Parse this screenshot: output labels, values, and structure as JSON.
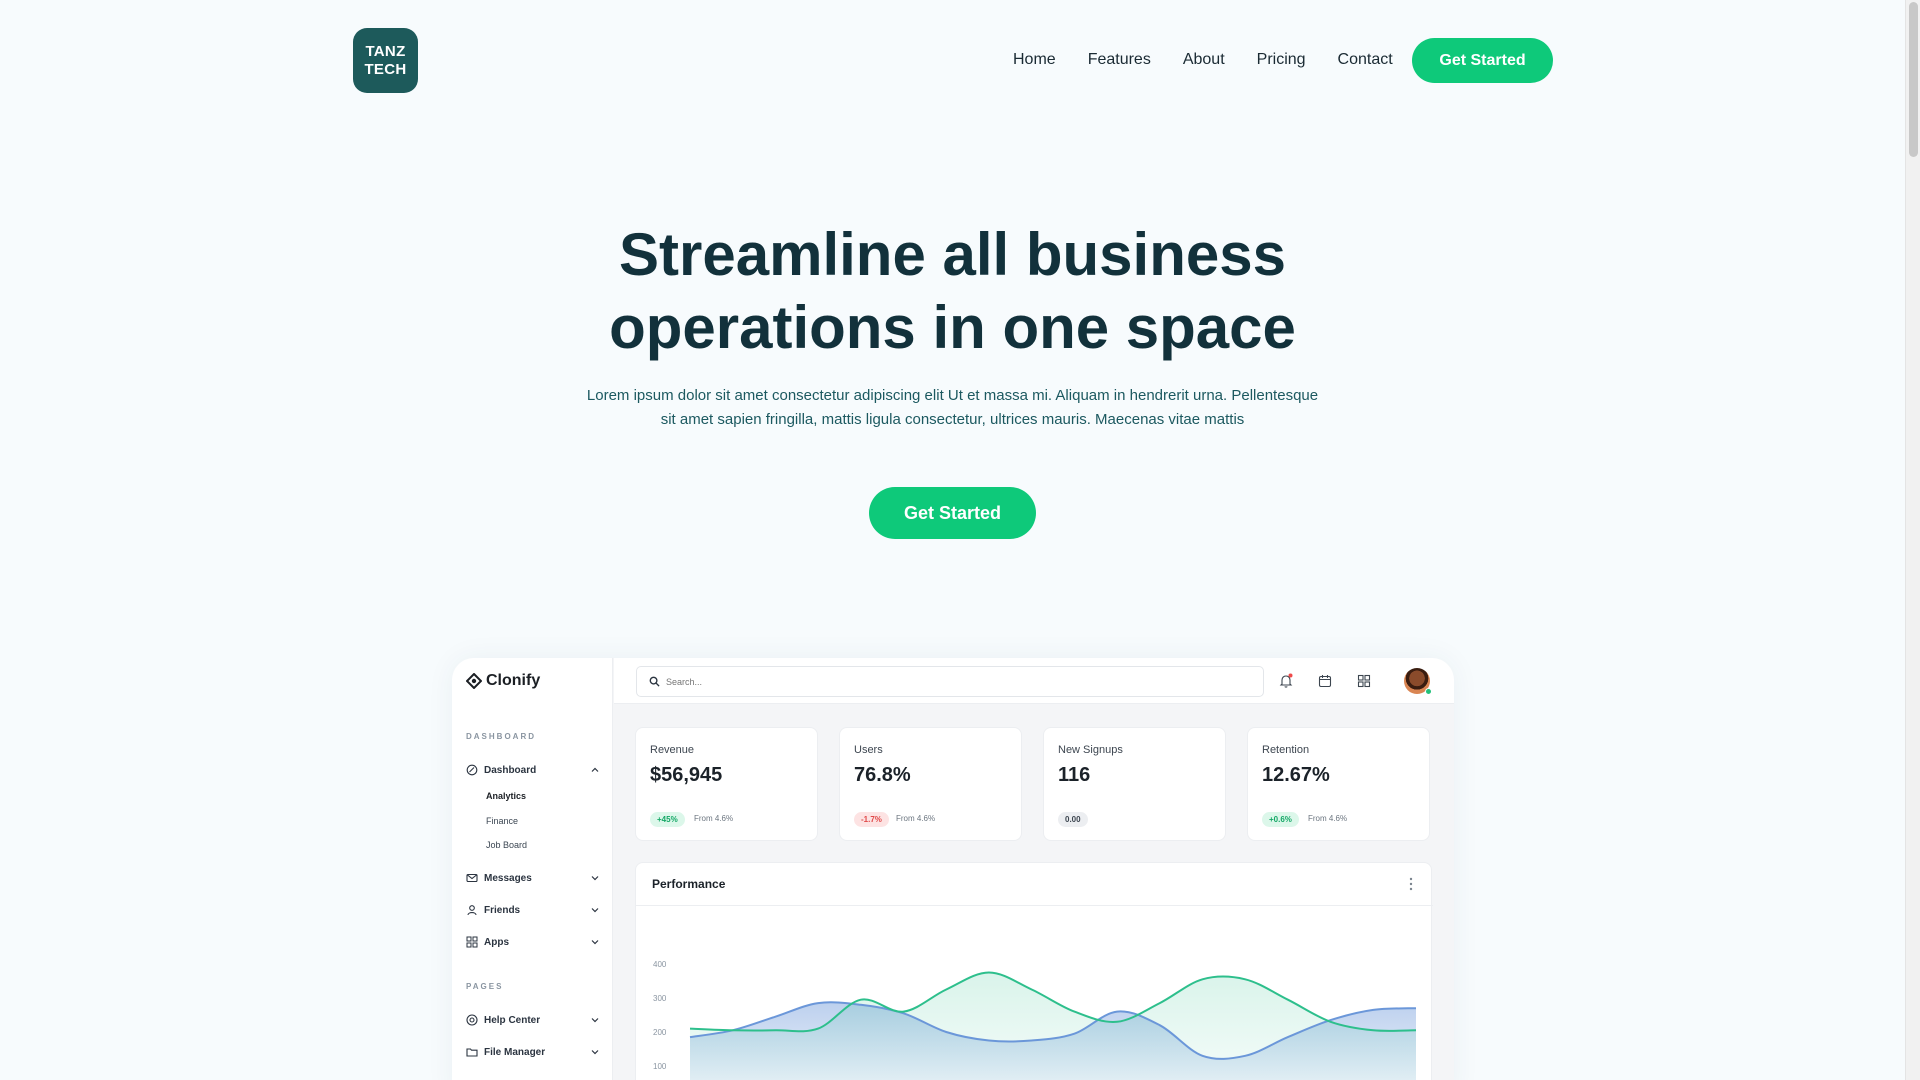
{
  "nav": {
    "logo_line1": "TANZ",
    "logo_line2": "TECH",
    "links": [
      "Home",
      "Features",
      "About",
      "Pricing",
      "Contact"
    ],
    "cta": "Get Started"
  },
  "hero": {
    "title_line1": "Streamline all business",
    "title_line2": "operations in one space",
    "subtitle_line1": "Lorem ipsum dolor sit amet consectetur adipiscing elit Ut et massa mi. Aliquam in hendrerit urna. Pellentesque",
    "subtitle_line2": "sit amet sapien fringilla, mattis ligula consectetur, ultrices mauris. Maecenas vitae mattis",
    "cta": "Get Started"
  },
  "dashboard": {
    "brand": "Clonify",
    "search_placeholder": "Search...",
    "sidebar": {
      "section1": "DASHBOARD",
      "dashboard": "Dashboard",
      "sub": [
        "Analytics",
        "Finance",
        "Job Board"
      ],
      "messages": "Messages",
      "friends": "Friends",
      "apps": "Apps",
      "section2": "PAGES",
      "help": "Help Center",
      "files": "File Manager"
    },
    "cards": [
      {
        "label": "Revenue",
        "value": "$56,945",
        "change": "+45%",
        "from": "From 4.6%",
        "trend": "up"
      },
      {
        "label": "Users",
        "value": "76.8%",
        "change": "-1.7%",
        "from": "From 4.6%",
        "trend": "down"
      },
      {
        "label": "New Signups",
        "value": "116",
        "change": "0.00",
        "from": "",
        "trend": "flat"
      },
      {
        "label": "Retention",
        "value": "12.67%",
        "change": "+0.6%",
        "from": "From 4.6%",
        "trend": "up"
      }
    ],
    "performance": {
      "title": "Performance"
    }
  },
  "colors": {
    "accent": "#0ec97a",
    "logo_bg": "#1d5a5b",
    "heading": "#12313b",
    "green_series": "#2dbf8c",
    "blue_series": "#6b97d9"
  },
  "chart_data": {
    "type": "area",
    "yticks": [
      "400",
      "300",
      "200",
      "100"
    ],
    "ylim": [
      0,
      400
    ],
    "x": [
      0,
      1,
      2,
      3,
      4,
      5,
      6,
      7,
      8,
      9,
      10,
      11,
      12,
      13,
      14,
      15,
      16,
      17
    ],
    "series": [
      {
        "values": [
          210,
          205,
          205,
          210,
          295,
          260,
          325,
          375,
          325,
          260,
          230,
          285,
          355,
          355,
          295,
          230,
          205,
          205
        ]
      },
      {
        "values": [
          185,
          205,
          245,
          285,
          280,
          255,
          200,
          175,
          175,
          195,
          260,
          220,
          130,
          130,
          185,
          235,
          265,
          270
        ]
      }
    ]
  }
}
